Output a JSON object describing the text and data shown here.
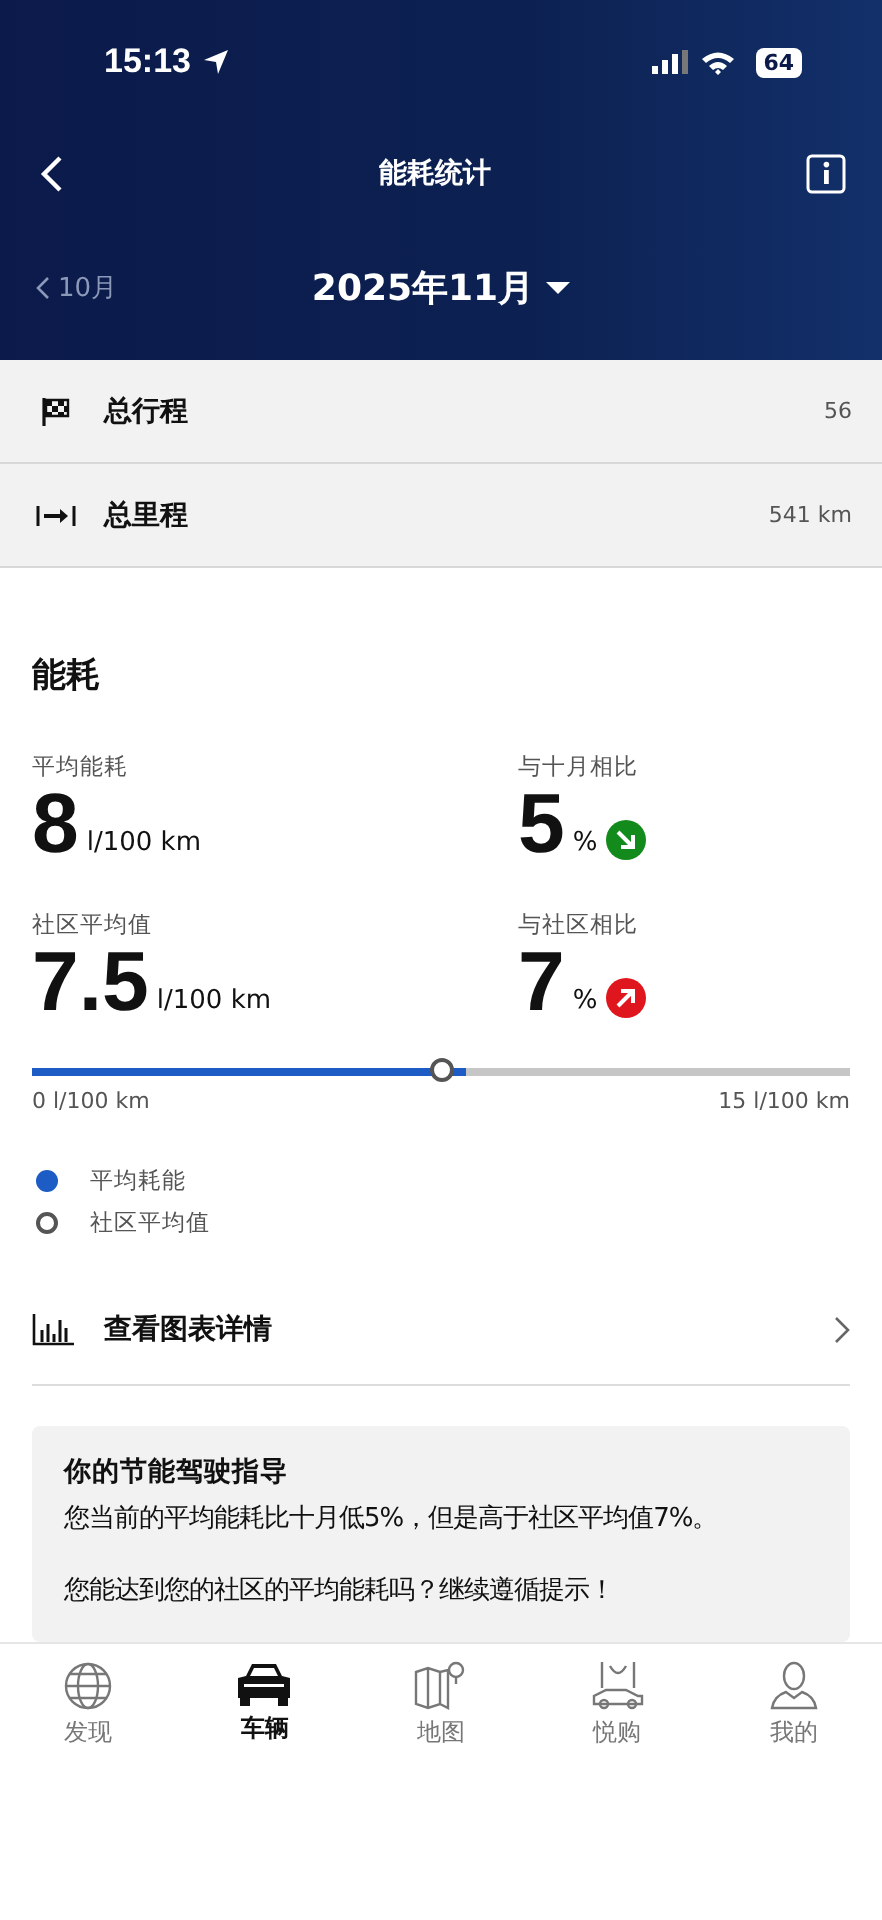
{
  "status_bar": {
    "time": "15:13",
    "battery": "64"
  },
  "header": {
    "title": "能耗统计",
    "prev_month": "10月",
    "month": "2025年11月"
  },
  "summary": [
    {
      "kind": "trips",
      "label": "总行程",
      "value": "56"
    },
    {
      "kind": "distance",
      "label": "总里程",
      "value": "541 km"
    }
  ],
  "consumption": {
    "title": "能耗",
    "stats": [
      {
        "label": "平均能耗",
        "value": "8",
        "unit": "l/100 km"
      },
      {
        "label": "与十月相比",
        "value": "5",
        "unit": "%",
        "kind": "down",
        "color": "#138a1c"
      },
      {
        "label": "社区平均值",
        "value": "7.5",
        "unit": "l/100 km"
      },
      {
        "label": "与社区相比",
        "value": "7",
        "unit": "%",
        "kind": "up",
        "color": "#e0161e"
      }
    ],
    "gauge": {
      "bar": {
        "level": 0.53
      },
      "marker": {
        "level": 0.5
      },
      "min_label": "0 l/100 km",
      "max_label": "15 l/100 km"
    },
    "legend": [
      {
        "kind": "dot",
        "label": "平均耗能"
      },
      {
        "kind": "ring",
        "label": "社区平均值"
      }
    ],
    "chart_link": "查看图表详情"
  },
  "tips": {
    "title": "你的节能驾驶指导",
    "paragraphs": [
      "您当前的平均能耗比十月低5%，但是高于社区平均值7%。",
      "您能达到您的社区的平均能耗吗？继续遵循提示！"
    ]
  },
  "tabs": [
    {
      "kind": "globe",
      "label": "发现",
      "selected": false
    },
    {
      "kind": "car",
      "label": "车辆",
      "selected": true
    },
    {
      "kind": "map",
      "label": "地图",
      "selected": false
    },
    {
      "kind": "shop",
      "label": "悦购",
      "selected": false
    },
    {
      "kind": "person",
      "label": "我的",
      "selected": false
    }
  ]
}
